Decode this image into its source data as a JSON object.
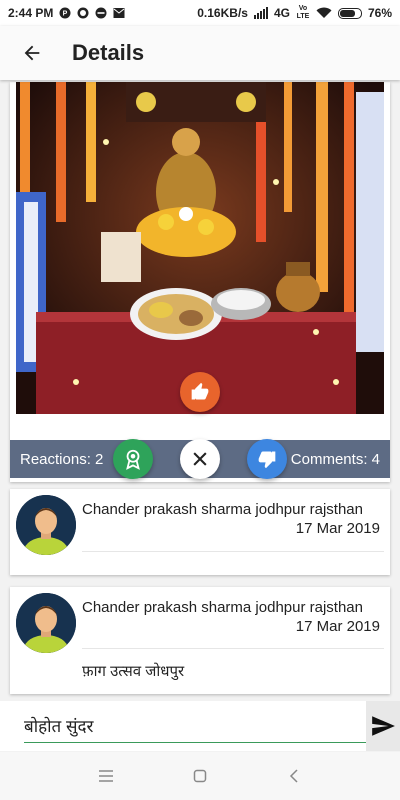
{
  "status_bar": {
    "time": "2:44 PM",
    "network_speed": "0.16KB/s",
    "network_type": "4G",
    "volte": "Vo LTE",
    "battery": "76%",
    "battery_level": 0.76
  },
  "app_bar": {
    "back_icon": "arrow-left-icon",
    "title": "Details"
  },
  "post": {
    "image_description_icon": "temple-shrine-photo",
    "reactions_label": "Reactions: 2",
    "comments_label": "Comments: 4",
    "buttons": {
      "like_icon": "thumbs-up-icon",
      "award_icon": "award-ribbon-icon",
      "close_icon": "close-icon",
      "dislike_icon": "thumbs-down-icon"
    },
    "colors": {
      "like": "#e8642c",
      "award": "#2ea35a",
      "dislike": "#3d86e0",
      "stats_bar": "#5d6b84"
    }
  },
  "comments": [
    {
      "author": "Chander prakash sharma jodhpur rajsthan",
      "date": "17 Mar 2019",
      "text": ""
    },
    {
      "author": "Chander prakash sharma jodhpur rajsthan",
      "date": "17 Mar 2019",
      "text": "फ़ाग उत्सव जोधपुर"
    }
  ],
  "composer": {
    "value": "बोहोत सुंदर",
    "send_icon": "send-icon"
  },
  "nav_bar": {
    "menu_icon": "menu-icon",
    "home_icon": "square-home-icon",
    "back_icon": "triangle-back-icon"
  }
}
